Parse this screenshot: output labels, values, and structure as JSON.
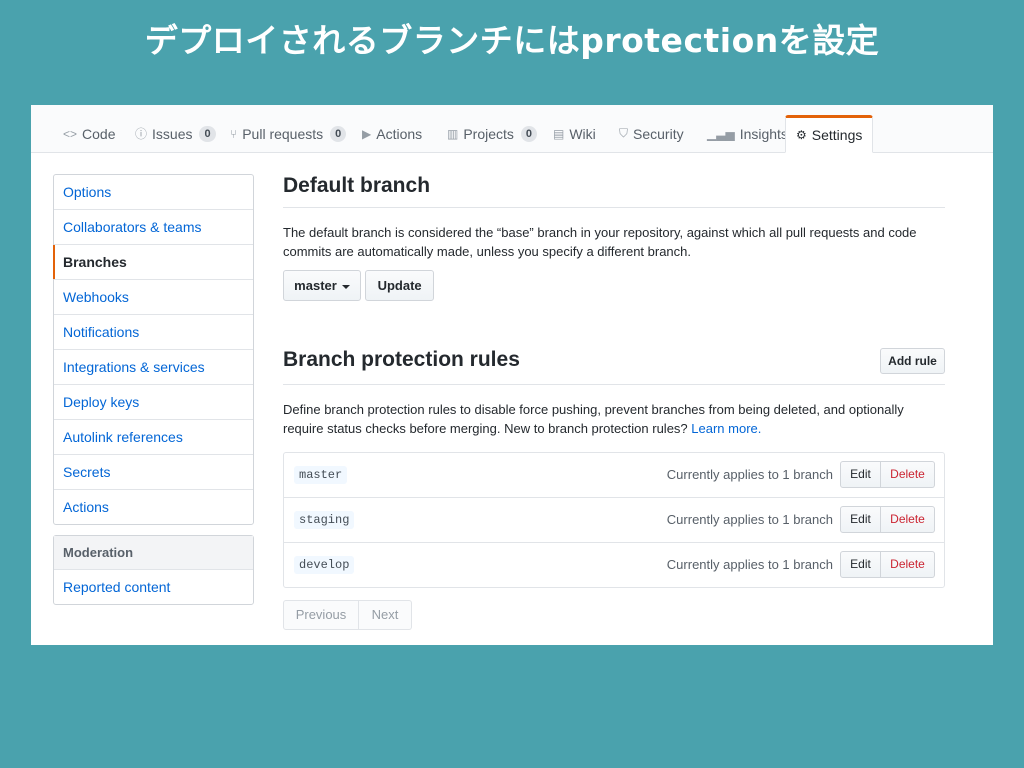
{
  "slide": {
    "title": "デプロイされるブランチにはprotectionを設定"
  },
  "tabs": [
    {
      "label": "Code",
      "icon": "code-icon"
    },
    {
      "label": "Issues",
      "count": "0",
      "icon": "issue-icon"
    },
    {
      "label": "Pull requests",
      "count": "0",
      "icon": "pull-request-icon"
    },
    {
      "label": "Actions",
      "icon": "play-icon"
    },
    {
      "label": "Projects",
      "count": "0",
      "icon": "project-icon"
    },
    {
      "label": "Wiki",
      "icon": "book-icon"
    },
    {
      "label": "Security",
      "icon": "shield-icon"
    },
    {
      "label": "Insights",
      "icon": "graph-icon"
    },
    {
      "label": "Settings",
      "icon": "gear-icon",
      "selected": true
    }
  ],
  "sidebar": {
    "items": [
      {
        "label": "Options"
      },
      {
        "label": "Collaborators & teams"
      },
      {
        "label": "Branches",
        "selected": true
      },
      {
        "label": "Webhooks"
      },
      {
        "label": "Notifications"
      },
      {
        "label": "Integrations & services"
      },
      {
        "label": "Deploy keys"
      },
      {
        "label": "Autolink references"
      },
      {
        "label": "Secrets"
      },
      {
        "label": "Actions"
      }
    ],
    "moderation": {
      "heading": "Moderation",
      "items": [
        {
          "label": "Reported content"
        }
      ]
    }
  },
  "default_branch": {
    "heading": "Default branch",
    "description": "The default branch is considered the “base” branch in your repository, against which all pull requests and code commits are automatically made, unless you specify a different branch.",
    "branch_select": "master",
    "update_button": "Update"
  },
  "protection": {
    "heading": "Branch protection rules",
    "add_rule_button": "Add rule",
    "description": "Define branch protection rules to disable force pushing, prevent branches from being deleted, and optionally require status checks before merging. New to branch protection rules?",
    "learn_more": "Learn more.",
    "rules": [
      {
        "name": "master",
        "applies": "Currently applies to 1 branch",
        "edit": "Edit",
        "delete": "Delete"
      },
      {
        "name": "staging",
        "applies": "Currently applies to 1 branch",
        "edit": "Edit",
        "delete": "Delete"
      },
      {
        "name": "develop",
        "applies": "Currently applies to 1 branch",
        "edit": "Edit",
        "delete": "Delete"
      }
    ]
  },
  "pagination": {
    "previous": "Previous",
    "next": "Next"
  },
  "colors": {
    "slide_background": "#4aa2ad",
    "link": "#0366d6",
    "accent": "#e36209",
    "danger": "#cb2431"
  }
}
